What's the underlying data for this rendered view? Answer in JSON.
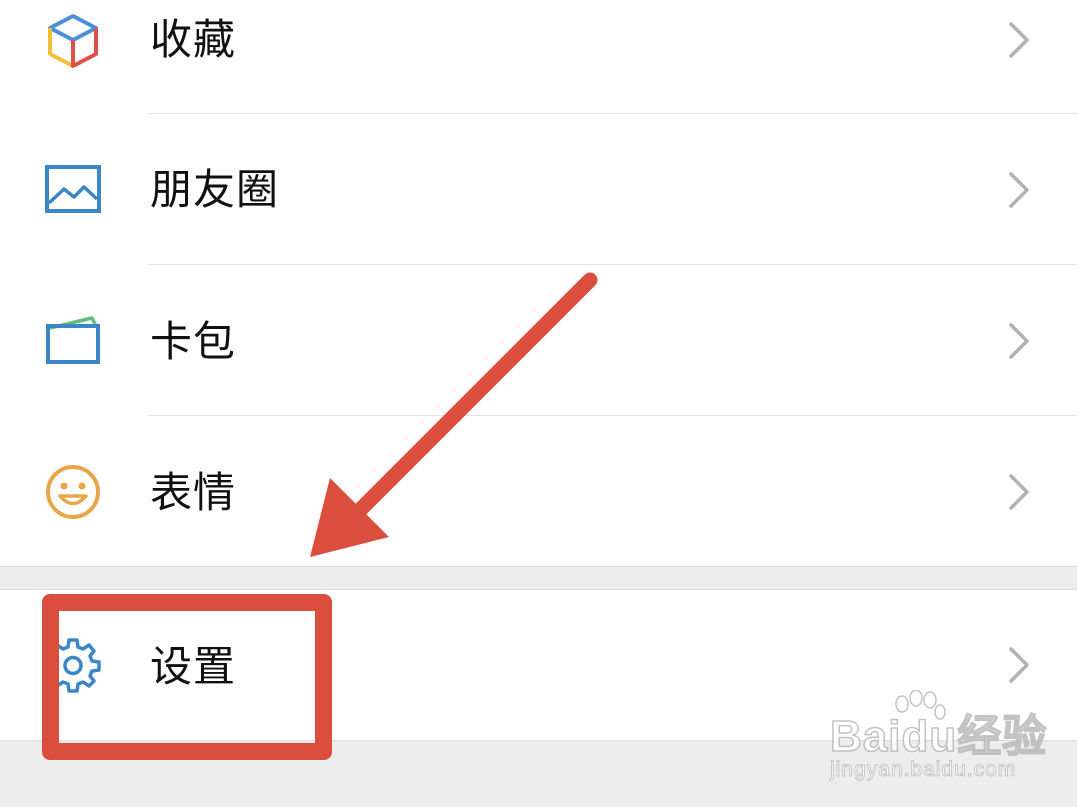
{
  "menu": {
    "items": [
      {
        "label": "收藏",
        "icon": "favorites-cube-icon"
      },
      {
        "label": "朋友圈",
        "icon": "moments-picture-icon"
      },
      {
        "label": "卡包",
        "icon": "card-wallet-icon"
      },
      {
        "label": "表情",
        "icon": "sticker-smiley-icon"
      }
    ],
    "settings": {
      "label": "设置",
      "icon": "gear-icon"
    },
    "chevron_icon": "chevron-right-icon"
  },
  "annotation": {
    "arrow_color": "#db4d3c",
    "box_color": "#db4d3c"
  },
  "watermark": {
    "brand": "Baidu经验",
    "url": "jingyan.baidu.com"
  },
  "colors": {
    "background": "#ededed",
    "row": "#ffffff",
    "text": "#111111",
    "chevron": "#b2b2b2",
    "icon_blue": "#3b86c9"
  }
}
